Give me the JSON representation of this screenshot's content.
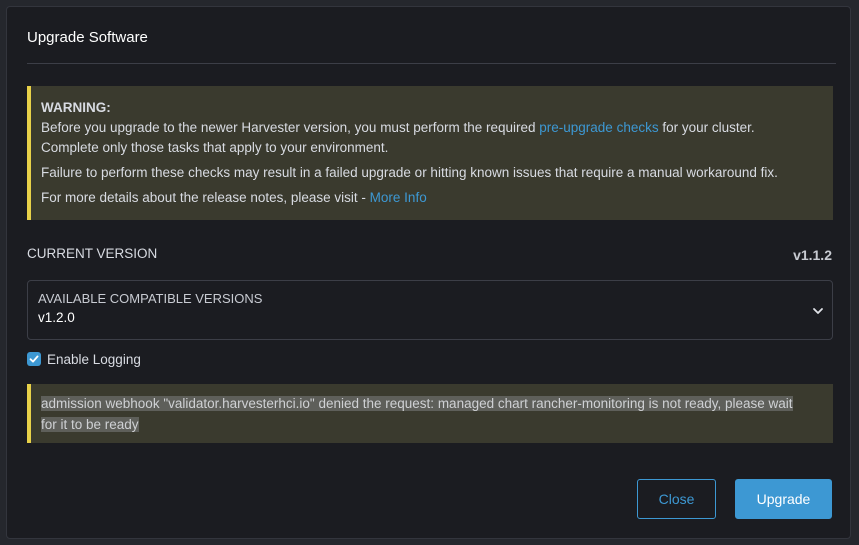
{
  "modal": {
    "title": "Upgrade Software"
  },
  "warning": {
    "heading": "WARNING:",
    "line1_prefix": "Before you upgrade to the newer Harvester version, you must perform the required ",
    "line1_link": "pre-upgrade checks",
    "line1_suffix": " for your cluster.",
    "line2": "Complete only those tasks that apply to your environment.",
    "line3": "Failure to perform these checks may result in a failed upgrade or hitting known issues that require a manual workaround fix.",
    "line4_prefix": "For more details about the release notes, please visit - ",
    "line4_link": "More Info"
  },
  "version": {
    "current_label": "CURRENT VERSION",
    "current_value": "v1.1.2",
    "select_label": "AVAILABLE COMPATIBLE VERSIONS",
    "select_value": "v1.2.0"
  },
  "logging": {
    "label": "Enable Logging",
    "checked": true
  },
  "error": {
    "message": "admission webhook \"validator.harvesterhci.io\" denied the request: managed chart rancher-monitoring is not ready, please wait for it to be ready"
  },
  "buttons": {
    "close": "Close",
    "upgrade": "Upgrade"
  },
  "colors": {
    "accent": "#3d98d3",
    "warning_border": "#e8d149",
    "banner_bg": "#3a3a2e",
    "modal_bg": "#1b1c21"
  },
  "icons": {
    "select": "chevron-down-icon",
    "checkbox": "checkmark-icon"
  }
}
